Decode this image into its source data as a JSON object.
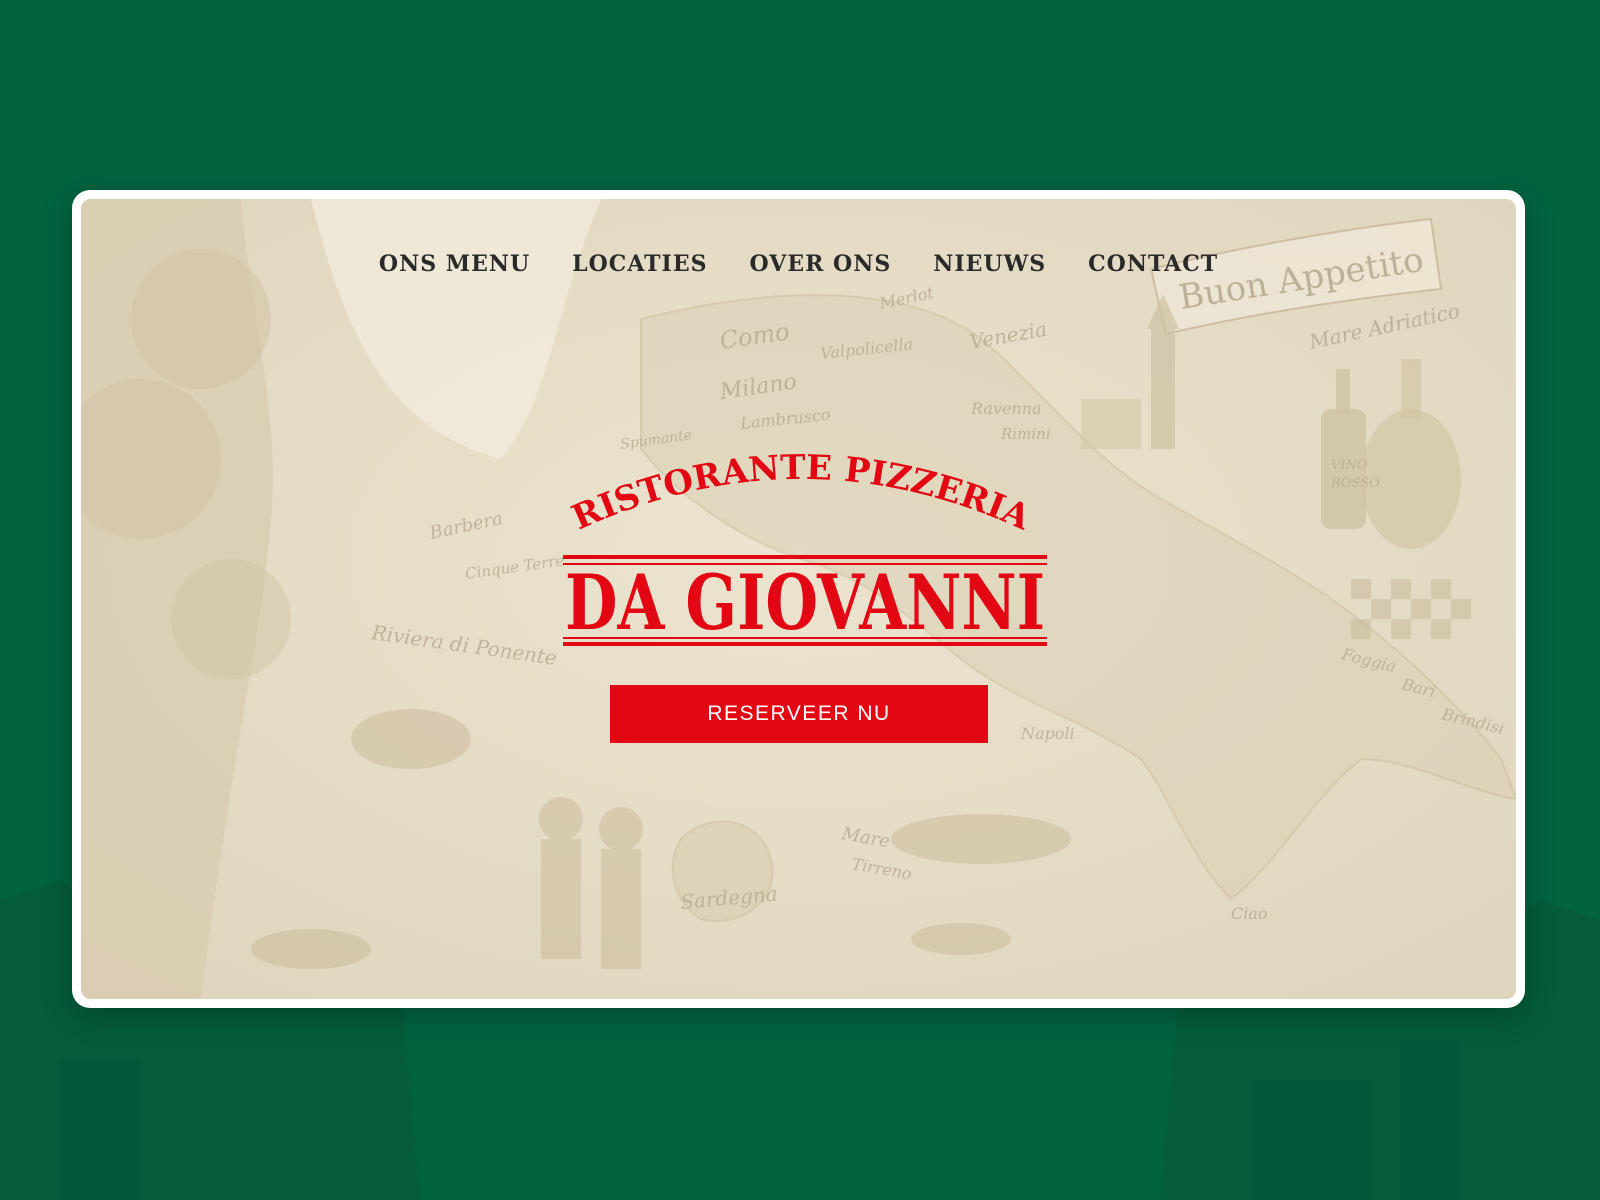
{
  "colors": {
    "page_background": "#02633f",
    "card_background": "#ffffff",
    "hero_background": "#e6dcc6",
    "brand_red": "#e30613",
    "nav_text": "#2a2a2a"
  },
  "nav": {
    "items": [
      {
        "label": "ONS MENU"
      },
      {
        "label": "LOCATIES"
      },
      {
        "label": "OVER ONS"
      },
      {
        "label": "NIEUWS"
      },
      {
        "label": "CONTACT"
      }
    ]
  },
  "hero": {
    "background_text": [
      "Buon Appetito",
      "Mare Adriatico",
      "Milano",
      "Venezia",
      "Como",
      "Sardegna",
      "Riviera di Ponente",
      "Ravenna",
      "Rimini",
      "Foggia",
      "Bari",
      "Brindisi",
      "Mare Tirreno",
      "Napoli",
      "Barbera",
      "Cinque Terre",
      "Spumante",
      "Lambrusco",
      "Valpolicella",
      "Merlot",
      "Ciao",
      "Vino Rosso"
    ],
    "logo": {
      "top_text": "RISTORANTE PIZZERIA",
      "main_text": "DA GIOVANNI"
    },
    "cta_label": "RESERVEER NU"
  }
}
